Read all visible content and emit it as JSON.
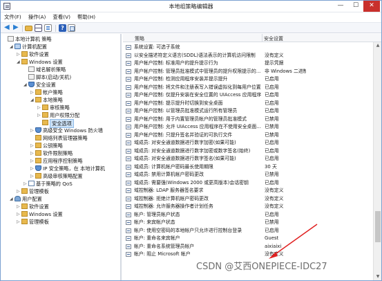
{
  "window": {
    "title": "本地组策略编辑器",
    "minimize": "—",
    "maximize": "☐",
    "close": "✕"
  },
  "menu": [
    "文件(F)",
    "操作(A)",
    "查看(V)",
    "帮助(H)"
  ],
  "tree": [
    {
      "label": "本地计算机 策略",
      "icon": "pol",
      "exp": "",
      "indent": 0
    },
    {
      "label": "计算机配置",
      "icon": "comp",
      "exp": "◢",
      "indent": 1
    },
    {
      "label": "软件设置",
      "icon": "fold",
      "exp": "▷",
      "indent": 2
    },
    {
      "label": "Windows 设置",
      "icon": "fold",
      "exp": "◢",
      "indent": 2
    },
    {
      "label": "域名解析策略",
      "icon": "pol",
      "exp": "",
      "indent": 3
    },
    {
      "label": "脚本(启动/关机)",
      "icon": "pol",
      "exp": "",
      "indent": 3
    },
    {
      "label": "安全设置",
      "icon": "shield",
      "exp": "◢",
      "indent": 3
    },
    {
      "label": "帐户策略",
      "icon": "fold",
      "exp": "▷",
      "indent": 4
    },
    {
      "label": "本地策略",
      "icon": "fold",
      "exp": "◢",
      "indent": 4
    },
    {
      "label": "审核策略",
      "icon": "fold",
      "exp": "▷",
      "indent": 5
    },
    {
      "label": "用户权限分配",
      "icon": "fold",
      "exp": "▷",
      "indent": 5
    },
    {
      "label": "安全选项",
      "icon": "fold",
      "exp": "",
      "indent": 5,
      "selected": true
    },
    {
      "label": "高级安全 Windows 防火墙",
      "icon": "shield",
      "exp": "▷",
      "indent": 4
    },
    {
      "label": "网络列表管理器策略",
      "icon": "fold",
      "exp": "",
      "indent": 4
    },
    {
      "label": "公钥策略",
      "icon": "fold",
      "exp": "▷",
      "indent": 4
    },
    {
      "label": "软件限制策略",
      "icon": "fold",
      "exp": "▷",
      "indent": 4
    },
    {
      "label": "应用程序控制策略",
      "icon": "fold",
      "exp": "▷",
      "indent": 4
    },
    {
      "label": "IP 安全策略，在 本地计算机",
      "icon": "shield",
      "exp": "▷",
      "indent": 4
    },
    {
      "label": "高级审核策略配置",
      "icon": "fold",
      "exp": "▷",
      "indent": 4
    },
    {
      "label": "基于策略的 QoS",
      "icon": "chart",
      "exp": "▷",
      "indent": 3
    },
    {
      "label": "管理模板",
      "icon": "fold",
      "exp": "▷",
      "indent": 2
    },
    {
      "label": "用户配置",
      "icon": "user",
      "exp": "◢",
      "indent": 1
    },
    {
      "label": "软件设置",
      "icon": "fold",
      "exp": "▷",
      "indent": 2
    },
    {
      "label": "Windows 设置",
      "icon": "fold",
      "exp": "▷",
      "indent": 2
    },
    {
      "label": "管理模板",
      "icon": "fold",
      "exp": "▷",
      "indent": 2
    }
  ],
  "list": {
    "col_policy": "策略",
    "col_setting": "安全设置",
    "rows": [
      [
        "系统设置: 可选子系统",
        ""
      ],
      [
        "以安全描述符定义语言(SDDL)语法表示的计算机访问限制",
        "没有定义"
      ],
      [
        "用户帐户控制: 标准用户的提升提示行为",
        "提示凭据"
      ],
      [
        "用户帐户控制: 管理员批准模式中管理员的提升权限提示的...",
        "非 Windows 二进制文"
      ],
      [
        "用户帐户控制: 检测应用程序安装并提示提升",
        "已启用"
      ],
      [
        "用户帐户控制: 将文件和注册表写入错误虚拟化到每用户位置",
        "已启用"
      ],
      [
        "用户帐户控制: 仅提升安装在安全位置的 UIAccess 应用程序",
        "已启用"
      ],
      [
        "用户帐户控制: 提示提升时切换到安全桌面",
        "已启用"
      ],
      [
        "用户帐户控制: 以管理员批准模式运行所有管理员",
        "已启用"
      ],
      [
        "用户帐户控制: 用于内置管理员帐户的管理员批准模式",
        "已禁用"
      ],
      [
        "用户帐户控制: 允许 UIAccess 应用程序在不使用安全桌面...",
        "已禁用"
      ],
      [
        "用户帐户控制: 只提升签名并验证的可执行文件",
        "已禁用"
      ],
      [
        "域成员: 对安全通道数据进行数字加密(如果可能)",
        "已启用"
      ],
      [
        "域成员: 对安全通道数据进行数字加密或数字签名(始终)",
        "已启用"
      ],
      [
        "域成员: 对安全通道数据进行数字签名(如果可能)",
        "已启用"
      ],
      [
        "域成员: 计算机帐户密码最长使用期限",
        "30 天"
      ],
      [
        "域成员: 禁用计算机帐户密码更改",
        "已禁用"
      ],
      [
        "域成员: 需要强(Windows 2000 或更高版本)会话密钥",
        "已启用"
      ],
      [
        "域控制器: LDAP 服务器签名要求",
        "没有定义"
      ],
      [
        "域控制器: 拒绝计算机帐户密码更改",
        "没有定义"
      ],
      [
        "域控制器: 允许服务器操作者计划任务",
        "没有定义"
      ],
      [
        "帐户: 管理员帐户状态",
        "已启用"
      ],
      [
        "帐户: 来宾帐户状态",
        "已禁用"
      ],
      [
        "帐户: 使用空密码的本地帐户只允许进行控制台登录",
        "已启用"
      ],
      [
        "帐户: 重命名来宾帐户",
        "Guest"
      ],
      [
        "帐户: 重命名系统管理员帐户",
        "aixiaixi"
      ],
      [
        "帐户: 阻止 Microsoft 帐户",
        "没有定义"
      ]
    ]
  },
  "watermark": "CSDN @艾西ONEPIECE-IDC27"
}
